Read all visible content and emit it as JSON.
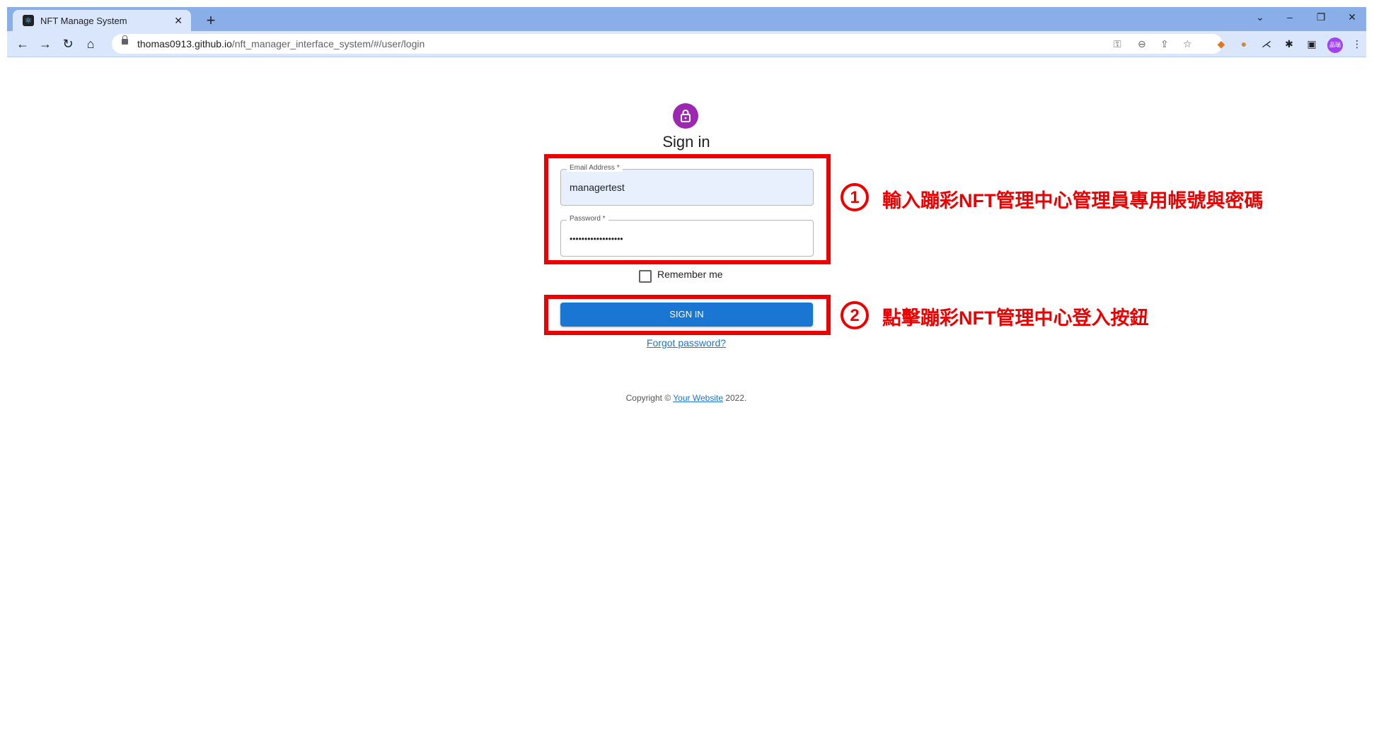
{
  "browser": {
    "tab_title": "NFT Manage System",
    "tab_close": "✕",
    "new_tab": "+",
    "url_host": "thomas0913.github.io",
    "url_path": "/nft_manager_interface_system/#/user/login",
    "window_controls": {
      "collapse": "⌄",
      "minimize": "–",
      "restore": "❐",
      "close": "✕"
    },
    "avatar_initials": "品瑞"
  },
  "form": {
    "title": "Sign in",
    "email_label": "Email Address *",
    "email_value": "managertest",
    "password_label": "Password *",
    "password_value": "••••••••••••••••••",
    "remember_label": "Remember me",
    "signin_label": "SIGN IN",
    "forgot_label": "Forgot password?"
  },
  "footer": {
    "prefix": "Copyright © ",
    "link": "Your Website",
    "suffix": " 2022."
  },
  "annotations": {
    "step1_number": "1",
    "step1_text": "輸入蹦彩NFT管理中心管理員專用帳號與密碼",
    "step2_number": "2",
    "step2_text": "點擊蹦彩NFT管理中心登入按鈕",
    "color": "#ee0000"
  },
  "colors": {
    "primary": "#1976d2",
    "avatar": "#9c27b0",
    "autofill": "#e8f0fe"
  }
}
